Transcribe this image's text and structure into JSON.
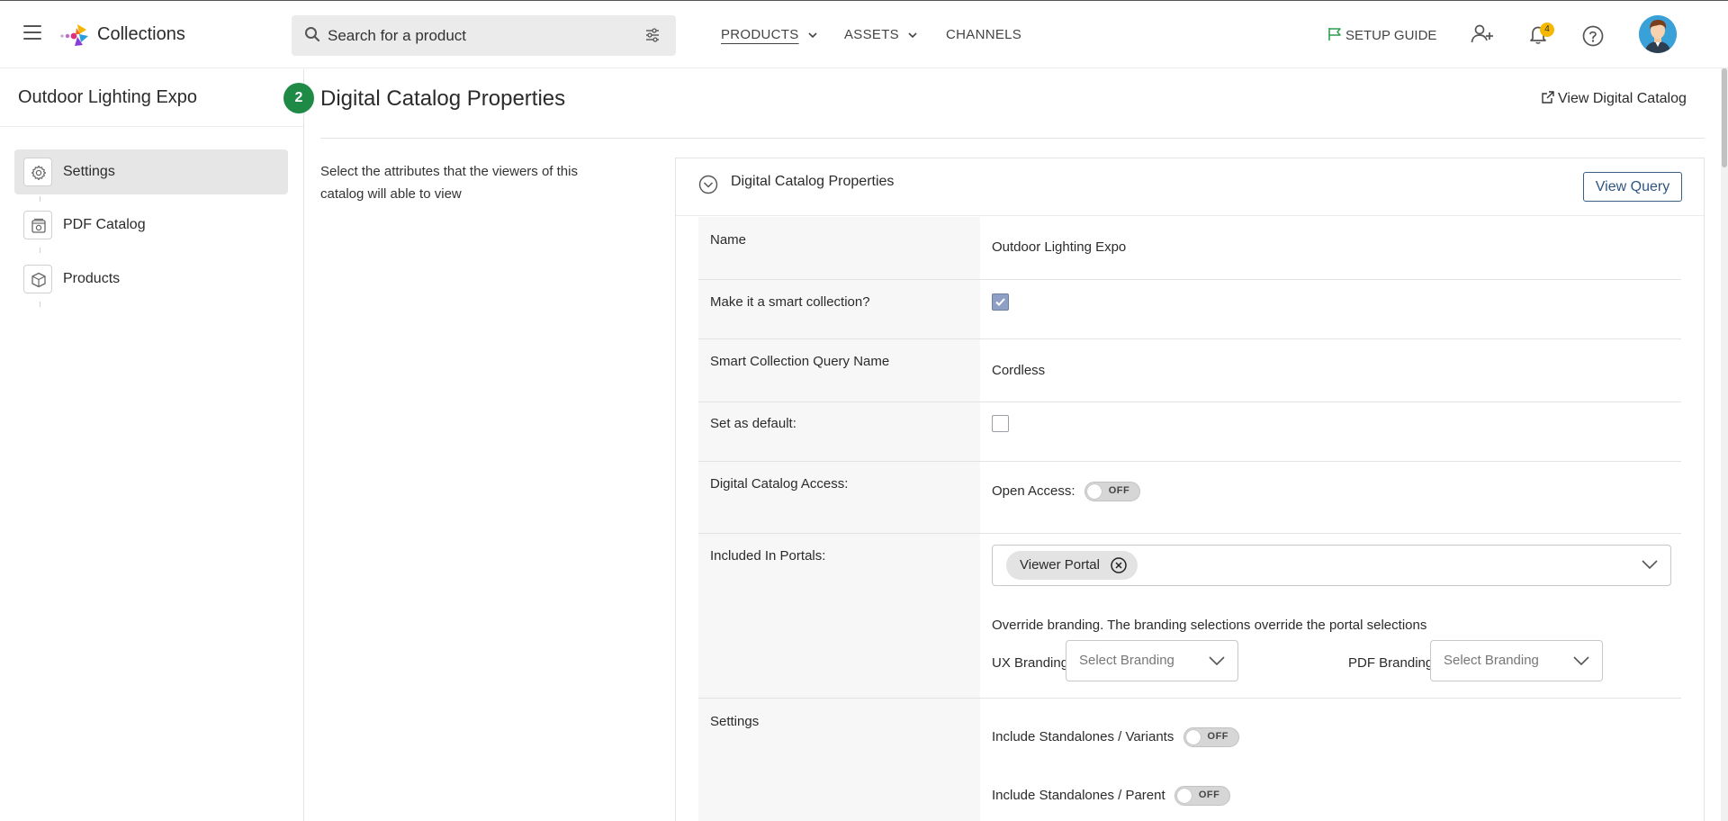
{
  "app": {
    "title": "Collections"
  },
  "search": {
    "placeholder": "Search for a product"
  },
  "nav": {
    "products": "PRODUCTS",
    "assets": "ASSETS",
    "channels": "CHANNELS",
    "setup_guide": "SETUP GUIDE",
    "notification_count": "4"
  },
  "sidebar": {
    "title": "Outdoor Lighting Expo",
    "step": "2",
    "items": [
      {
        "label": "Settings",
        "icon": "gear-icon",
        "active": true
      },
      {
        "label": "PDF Catalog",
        "icon": "pdf-catalog-icon",
        "active": false
      },
      {
        "label": "Products",
        "icon": "box-icon",
        "active": false
      }
    ]
  },
  "main": {
    "title": "Digital Catalog Properties",
    "view_catalog": "View Digital Catalog",
    "description": "Select the attributes that the viewers of this catalog will able to view"
  },
  "panel": {
    "title": "Digital Catalog Properties",
    "view_query": "View Query",
    "rows": {
      "name": {
        "label": "Name",
        "value": "Outdoor Lighting Expo"
      },
      "smart": {
        "label": "Make it a smart collection?",
        "checked": true
      },
      "query_name": {
        "label": "Smart Collection Query Name",
        "value": "Cordless"
      },
      "default": {
        "label": "Set as default:",
        "checked": false
      },
      "access": {
        "label": "Digital Catalog Access:",
        "open_access_label": "Open Access:",
        "toggle": "OFF"
      },
      "portals": {
        "label": "Included In Portals:",
        "chip": "Viewer Portal",
        "override_text": "Override branding. The branding selections override the portal selections",
        "ux_label": "UX Branding",
        "ux_placeholder": "Select Branding",
        "pdf_label": "PDF Branding",
        "pdf_placeholder": "Select Branding"
      },
      "settings": {
        "label": "Settings",
        "variants_label": "Include Standalones / Variants",
        "variants_toggle": "OFF",
        "parent_label": "Include Standalones / Parent",
        "parent_toggle": "OFF"
      }
    }
  },
  "colors": {
    "step_badge": "#1f8a45",
    "view_query_border": "#3a5f86",
    "notification_badge": "#f5b800",
    "setup_flag": "#2e9e4f"
  }
}
